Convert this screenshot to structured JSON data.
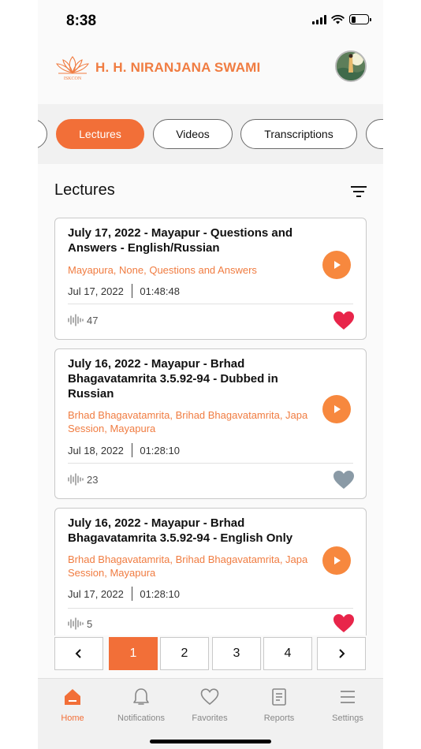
{
  "status": {
    "time": "8:38"
  },
  "header": {
    "title": "H. H. NIRANJANA SWAMI",
    "logo_text": "ISKCON"
  },
  "tabs": [
    {
      "label": ""
    },
    {
      "label": "Lectures",
      "active": true
    },
    {
      "label": "Videos"
    },
    {
      "label": "Transcriptions"
    },
    {
      "label": ""
    }
  ],
  "section": {
    "title": "Lectures"
  },
  "lectures": [
    {
      "title": "July 17, 2022 - Mayapur - Questions and Answers - English/Russian",
      "tags": "Mayapura, None, Questions and Answers",
      "date": "Jul 17, 2022",
      "duration": "01:48:48",
      "listens": "47",
      "favorite": true
    },
    {
      "title": "July 16, 2022 - Mayapur - Brhad Bhagavatamrita 3.5.92-94 - Dubbed in Russian",
      "tags": "Brhad Bhagavatamrita, Brihad Bhagavatamrita, Japa Session, Mayapura",
      "date": "Jul 18, 2022",
      "duration": "01:28:10",
      "listens": "23",
      "favorite": false
    },
    {
      "title": "July 16, 2022 - Mayapur - Brhad Bhagavatamrita 3.5.92-94 - English Only",
      "tags": "Brhad Bhagavatamrita, Brihad Bhagavatamrita, Japa Session, Mayapura",
      "date": "Jul 17, 2022",
      "duration": "01:28:10",
      "listens": "5",
      "favorite": true
    }
  ],
  "pagination": {
    "pages": [
      "1",
      "2",
      "3",
      "4"
    ],
    "current": "1"
  },
  "nav": [
    {
      "label": "Home",
      "icon": "home-icon",
      "active": true
    },
    {
      "label": "Notifications",
      "icon": "bell-icon"
    },
    {
      "label": "Favorites",
      "icon": "heart-icon"
    },
    {
      "label": "Reports",
      "icon": "reports-icon"
    },
    {
      "label": "Settings",
      "icon": "menu-icon"
    }
  ],
  "colors": {
    "accent": "#f26f38",
    "tag": "#f07c41",
    "heart_active": "#e8254a",
    "heart_inactive": "#8a9aa6"
  }
}
